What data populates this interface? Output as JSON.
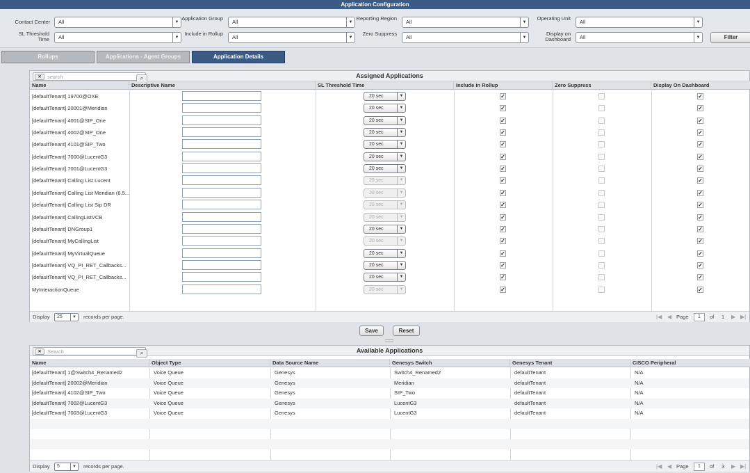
{
  "window": {
    "title": "Application Configuration"
  },
  "filters": {
    "contact_center": {
      "label": "Contact Center",
      "value": "All"
    },
    "application_group": {
      "label": "Application Group",
      "value": "All"
    },
    "reporting_region": {
      "label": "Reporting Region",
      "value": "All"
    },
    "operating_unit": {
      "label": "Operating Unit",
      "value": "All"
    },
    "sl_threshold_time": {
      "label": "SL Threshold Time",
      "value": "All"
    },
    "include_in_rollup": {
      "label": "Include in Rollup",
      "value": "All"
    },
    "zero_suppress": {
      "label": "Zero Suppress",
      "value": "All"
    },
    "display_on_dashboard": {
      "label": "Display on Dashboard",
      "value": "All"
    },
    "filter_button": "Filter"
  },
  "tabs": [
    {
      "label": "Rollups",
      "active": false
    },
    {
      "label": "Applications - Agent Groups",
      "active": false
    },
    {
      "label": "Application Details",
      "active": true
    }
  ],
  "assigned": {
    "title": "Assigned Applications",
    "search_placeholder": "search",
    "columns": [
      "Name",
      "Descriptive Name",
      "SL Threshold Time",
      "Include in Rollup",
      "Zero Suppress",
      "Display On Dashboard"
    ],
    "rows": [
      {
        "name": "[defaultTenant] 19700@OXE",
        "sl": "20 sec",
        "sl_enabled": true,
        "rollup": true,
        "zero": false,
        "dashboard": true
      },
      {
        "name": "[defaultTenant] 20001@Meridian",
        "sl": "20 sec",
        "sl_enabled": true,
        "rollup": true,
        "zero": false,
        "dashboard": true
      },
      {
        "name": "[defaultTenant] 4001@SIP_One",
        "sl": "20 sec",
        "sl_enabled": true,
        "rollup": true,
        "zero": false,
        "dashboard": true
      },
      {
        "name": "[defaultTenant] 4002@SIP_One",
        "sl": "20 sec",
        "sl_enabled": true,
        "rollup": true,
        "zero": false,
        "dashboard": true
      },
      {
        "name": "[defaultTenant] 4101@SIP_Two",
        "sl": "20 sec",
        "sl_enabled": true,
        "rollup": true,
        "zero": false,
        "dashboard": true
      },
      {
        "name": "[defaultTenant] 7000@LucentG3",
        "sl": "20 sec",
        "sl_enabled": true,
        "rollup": true,
        "zero": false,
        "dashboard": true
      },
      {
        "name": "[defaultTenant] 7001@LucentG3",
        "sl": "20 sec",
        "sl_enabled": true,
        "rollup": true,
        "zero": false,
        "dashboard": true
      },
      {
        "name": "[defaultTenant] Calling List Lucent",
        "sl": "20 sec",
        "sl_enabled": false,
        "rollup": true,
        "zero": false,
        "dashboard": true
      },
      {
        "name": "[defaultTenant] Calling List Meridian (6.5...",
        "sl": "20 sec",
        "sl_enabled": false,
        "rollup": true,
        "zero": false,
        "dashboard": true
      },
      {
        "name": "[defaultTenant] Calling List Sip DR",
        "sl": "20 sec",
        "sl_enabled": false,
        "rollup": true,
        "zero": false,
        "dashboard": true
      },
      {
        "name": "[defaultTenant] CallingListVCB",
        "sl": "20 sec",
        "sl_enabled": false,
        "rollup": true,
        "zero": false,
        "dashboard": true
      },
      {
        "name": "[defaultTenant] DNGroup1",
        "sl": "20 sec",
        "sl_enabled": true,
        "rollup": true,
        "zero": false,
        "dashboard": true
      },
      {
        "name": "[defaultTenant] MyCallingList",
        "sl": "20 sec",
        "sl_enabled": false,
        "rollup": true,
        "zero": false,
        "dashboard": true
      },
      {
        "name": "[defaultTenant] MyVirtualQueue",
        "sl": "20 sec",
        "sl_enabled": true,
        "rollup": true,
        "zero": false,
        "dashboard": true
      },
      {
        "name": "[defaultTenant] VQ_PI_RET_Callbacks...",
        "sl": "20 sec",
        "sl_enabled": true,
        "rollup": true,
        "zero": false,
        "dashboard": true
      },
      {
        "name": "[defaultTenant] VQ_PI_RET_Callbacks...",
        "sl": "20 sec",
        "sl_enabled": true,
        "rollup": true,
        "zero": false,
        "dashboard": true
      },
      {
        "name": "MyInteractionQueue",
        "sl": "20 sec",
        "sl_enabled": false,
        "rollup": true,
        "zero": false,
        "dashboard": true
      }
    ],
    "footer": {
      "display": "Display",
      "page_size": "25",
      "records_per_page": "records per page.",
      "page_label": "Page",
      "page": "1",
      "of": "of",
      "total_pages": "1"
    }
  },
  "buttons": {
    "save": "Save",
    "reset": "Reset"
  },
  "available": {
    "title": "Available Applications",
    "search_placeholder": "Search",
    "columns": [
      "Name",
      "Object Type",
      "Data Source Name",
      "Genesys Switch",
      "Genesys Tenant",
      "CISCO Peripheral"
    ],
    "rows": [
      [
        "[defaultTenant] 1@Switch4_Renamed2",
        "Voice Queue",
        "Genesys",
        "Switch4_Renamed2",
        "defaultTenant",
        "N/A"
      ],
      [
        "[defaultTenant] 20002@Meridian",
        "Voice Queue",
        "Genesys",
        "Meridian",
        "defaultTenant",
        "N/A"
      ],
      [
        "[defaultTenant] 4102@SIP_Two",
        "Voice Queue",
        "Genesys",
        "SIP_Two",
        "defaultTenant",
        "N/A"
      ],
      [
        "[defaultTenant] 7002@LucentG3",
        "Voice Queue",
        "Genesys",
        "LucentG3",
        "defaultTenant",
        "N/A"
      ],
      [
        "[defaultTenant] 7003@LucentG3",
        "Voice Queue",
        "Genesys",
        "LucentG3",
        "defaultTenant",
        "N/A"
      ]
    ],
    "footer": {
      "display": "Display",
      "page_size": "5",
      "records_per_page": "records per page.",
      "page_label": "Page",
      "page": "1",
      "of": "of",
      "total_pages": "3"
    }
  },
  "icons": {
    "sort_asc": "sort-ascending-icon",
    "dropdown": "chevron-down-icon",
    "search": "magnifier-icon",
    "clear": "clear-x-icon",
    "pager": [
      "first-page-icon",
      "prev-page-icon",
      "next-page-icon",
      "last-page-icon"
    ]
  },
  "colors": {
    "accent": "#3b5a84",
    "header_bg": "#dfe2e6",
    "panel_bg": "#dfe3e8"
  }
}
